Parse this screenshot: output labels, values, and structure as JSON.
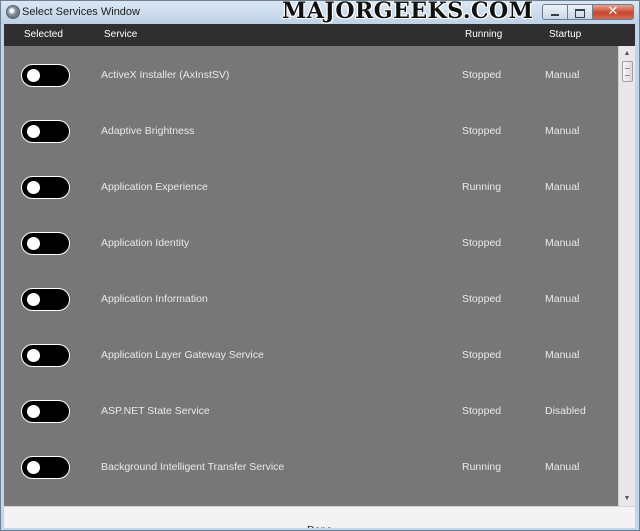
{
  "window": {
    "title": "Select Services Window",
    "watermark": "MAJORGEEKS.COM",
    "controls": {
      "close_glyph": "✕"
    }
  },
  "table": {
    "headers": {
      "selected": "Selected",
      "service": "Service",
      "running": "Running",
      "startup": "Startup"
    },
    "rows": [
      {
        "selected": false,
        "service": "ActiveX Installer (AxInstSV)",
        "running": "Stopped",
        "startup": "Manual"
      },
      {
        "selected": false,
        "service": "Adaptive Brightness",
        "running": "Stopped",
        "startup": "Manual"
      },
      {
        "selected": false,
        "service": "Application Experience",
        "running": "Running",
        "startup": "Manual"
      },
      {
        "selected": false,
        "service": "Application Identity",
        "running": "Stopped",
        "startup": "Manual"
      },
      {
        "selected": false,
        "service": "Application Information",
        "running": "Stopped",
        "startup": "Manual"
      },
      {
        "selected": false,
        "service": "Application Layer Gateway Service",
        "running": "Stopped",
        "startup": "Manual"
      },
      {
        "selected": false,
        "service": "ASP.NET State Service",
        "running": "Stopped",
        "startup": "Disabled"
      },
      {
        "selected": false,
        "service": "Background Intelligent Transfer Service",
        "running": "Running",
        "startup": "Manual"
      }
    ]
  },
  "footer": {
    "done_label": "Done"
  },
  "colors": {
    "content_bg": "#777777",
    "header_bg": "#2f2f2f",
    "toggle_off": "#000000",
    "text_light": "#e9e9e9"
  }
}
